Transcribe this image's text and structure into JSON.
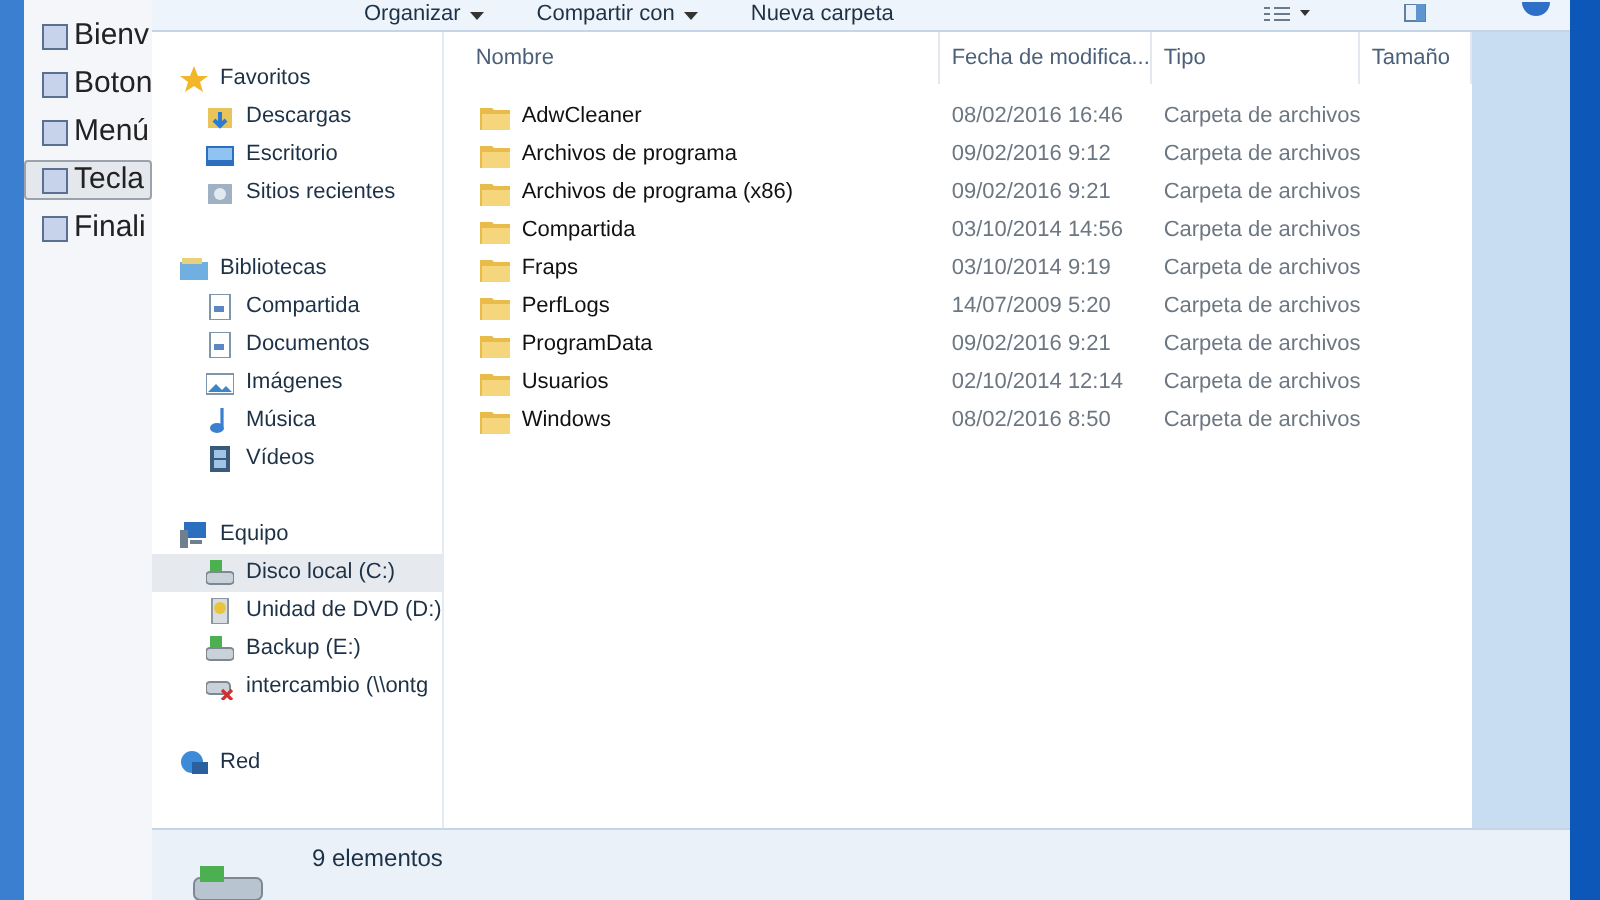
{
  "background_dialog": {
    "nav_items": [
      {
        "label": "Bienv",
        "selected": false
      },
      {
        "label": "Boton",
        "selected": false
      },
      {
        "label": "Menú",
        "selected": false
      },
      {
        "label": "Tecla",
        "selected": true
      },
      {
        "label": "Finali",
        "selected": false
      }
    ]
  },
  "explorer": {
    "toolbar": [
      {
        "label": "Organizar",
        "dropdown": true
      },
      {
        "label": "Compartir con",
        "dropdown": true
      },
      {
        "label": "Nueva carpeta",
        "dropdown": false
      }
    ],
    "nav": [
      {
        "label": "Favoritos",
        "kind": "star",
        "children": [
          {
            "label": "Descargas",
            "kind": "download",
            "selected": false
          },
          {
            "label": "Escritorio",
            "kind": "desktop",
            "selected": false
          },
          {
            "label": "Sitios recientes",
            "kind": "recent",
            "selected": false
          }
        ]
      },
      {
        "label": "Bibliotecas",
        "kind": "library",
        "children": [
          {
            "label": "Compartida",
            "kind": "doc",
            "selected": false
          },
          {
            "label": "Documentos",
            "kind": "doc",
            "selected": false
          },
          {
            "label": "Imágenes",
            "kind": "image",
            "selected": false
          },
          {
            "label": "Música",
            "kind": "music",
            "selected": false
          },
          {
            "label": "Vídeos",
            "kind": "video",
            "selected": false
          }
        ]
      },
      {
        "label": "Equipo",
        "kind": "computer",
        "children": [
          {
            "label": "Disco local (C:)",
            "kind": "drive",
            "selected": true
          },
          {
            "label": "Unidad de DVD (D:)",
            "kind": "dvd",
            "selected": false
          },
          {
            "label": "Backup (E:)",
            "kind": "drive",
            "selected": false
          },
          {
            "label": "intercambio (\\\\ontg",
            "kind": "netdrive",
            "selected": false
          }
        ]
      },
      {
        "label": "Red",
        "kind": "network"
      }
    ],
    "columns": [
      "Nombre",
      "Fecha de modifica...",
      "Tipo",
      "Tamaño"
    ],
    "rows": [
      {
        "name": "AdwCleaner",
        "date": "08/02/2016 16:46",
        "type": "Carpeta de archivos"
      },
      {
        "name": "Archivos de programa",
        "date": "09/02/2016 9:12",
        "type": "Carpeta de archivos"
      },
      {
        "name": "Archivos de programa (x86)",
        "date": "09/02/2016 9:21",
        "type": "Carpeta de archivos"
      },
      {
        "name": "Compartida",
        "date": "03/10/2014 14:56",
        "type": "Carpeta de archivos"
      },
      {
        "name": "Fraps",
        "date": "03/10/2014 9:19",
        "type": "Carpeta de archivos"
      },
      {
        "name": "PerfLogs",
        "date": "14/07/2009 5:20",
        "type": "Carpeta de archivos"
      },
      {
        "name": "ProgramData",
        "date": "09/02/2016 9:21",
        "type": "Carpeta de archivos"
      },
      {
        "name": "Usuarios",
        "date": "02/10/2014 12:14",
        "type": "Carpeta de archivos"
      },
      {
        "name": "Windows",
        "date": "08/02/2016 8:50",
        "type": "Carpeta de archivos"
      }
    ],
    "status_bar": {
      "count": "9 elementos"
    }
  }
}
